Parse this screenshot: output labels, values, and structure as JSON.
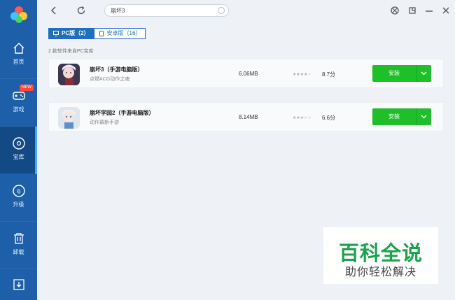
{
  "sidebar": {
    "items": [
      {
        "label": "首页",
        "icon": "home-icon"
      },
      {
        "label": "游戏",
        "icon": "gamepad-icon",
        "badge": "NEW"
      },
      {
        "label": "宝库",
        "icon": "disc-icon",
        "active": true
      },
      {
        "label": "升级",
        "icon": "upgrade-icon",
        "badge_count": "6"
      },
      {
        "label": "卸载",
        "icon": "trash-icon"
      },
      {
        "label": "",
        "icon": "download-icon"
      }
    ]
  },
  "search": {
    "value": "崩坏3"
  },
  "tabs": [
    {
      "label": "PC版（2）",
      "active": true,
      "icon": "monitor-icon"
    },
    {
      "label": "安卓版（16）",
      "active": false,
      "icon": "phone-icon"
    }
  ],
  "results_text": "2 款软件来自PC宝库",
  "apps": [
    {
      "name": "崩坏3（手游电脑版）",
      "desc": "点燃ACG动作之魂",
      "size": "6.06MB",
      "stars": 4,
      "score": "8.7分",
      "button": "安装"
    },
    {
      "name": "崩坏学园2（手游电脑版）",
      "desc": "动作幕新手游",
      "size": "8.14MB",
      "stars": 3,
      "score": "6.6分",
      "button": "安装"
    }
  ],
  "watermark": {
    "title": "百科全说",
    "subtitle": "助你轻松解决"
  },
  "colors": {
    "sidebar": "#1d5fa8",
    "accent": "#1d6fc4",
    "install": "#1fbf2a",
    "brand_green": "#1aa34a"
  }
}
